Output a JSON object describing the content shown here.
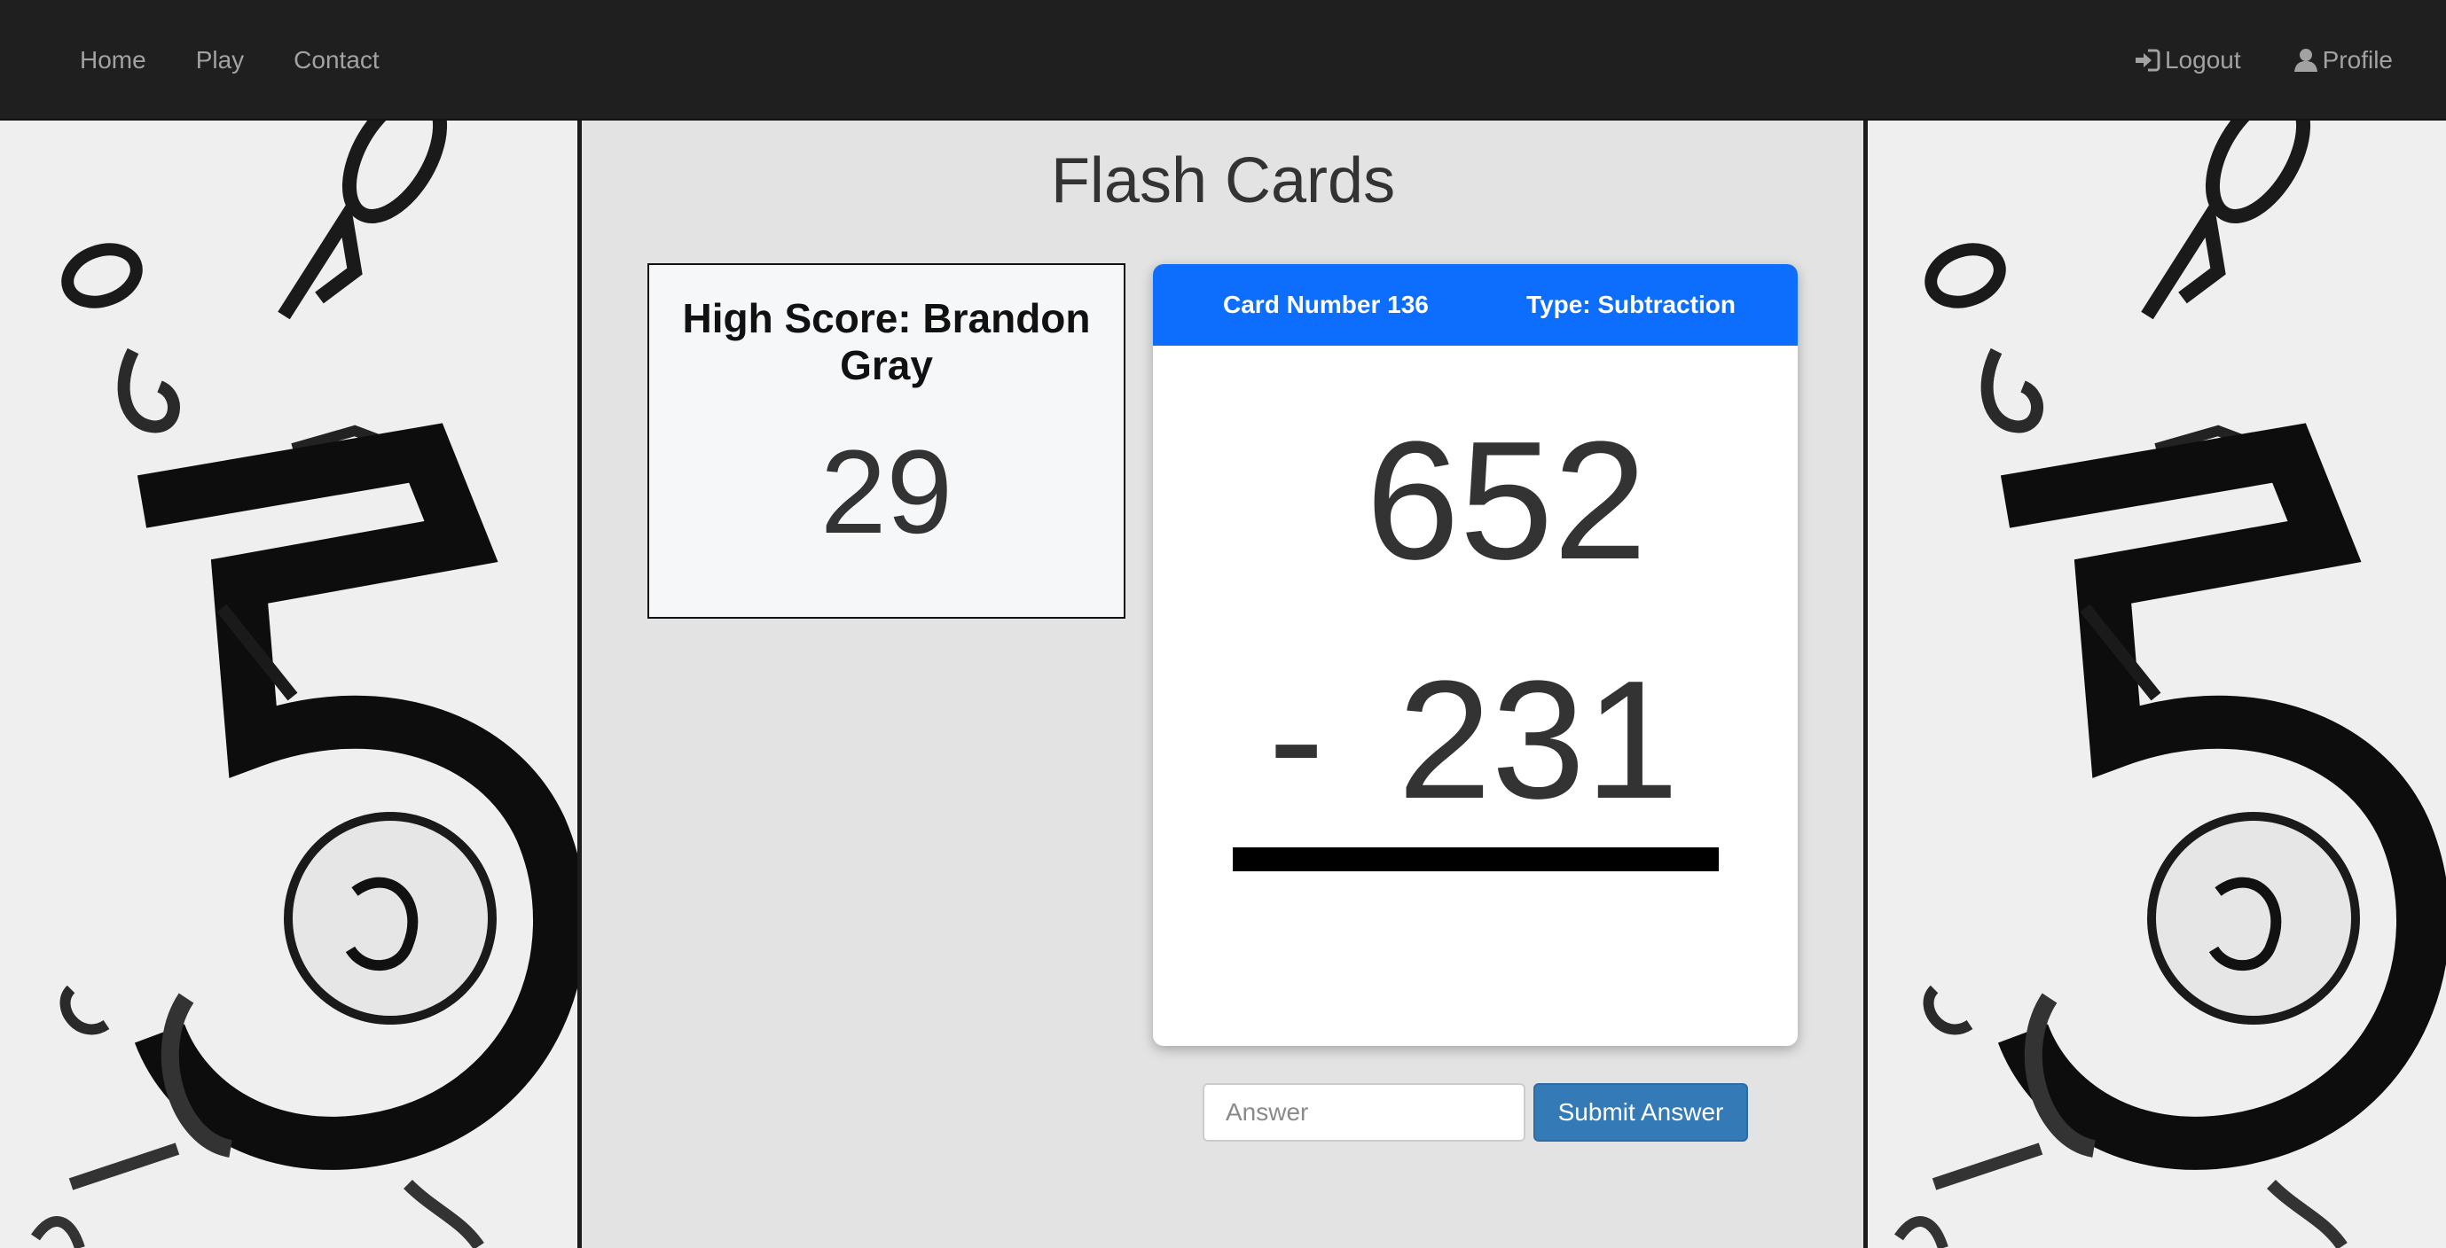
{
  "nav": {
    "left_links": [
      {
        "label": "Home"
      },
      {
        "label": "Play"
      },
      {
        "label": "Contact"
      }
    ],
    "logout_label": "Logout",
    "profile_label": "Profile"
  },
  "page": {
    "title": "Flash Cards"
  },
  "high_score": {
    "label": "High Score: Brandon Gray",
    "value": "29"
  },
  "card": {
    "number_label": "Card Number 136",
    "type_label": "Type: Subtraction",
    "top_operand": "652",
    "operator": "-",
    "bottom_operand": "231"
  },
  "answer_form": {
    "placeholder": "Answer",
    "submit_label": "Submit Answer"
  },
  "colors": {
    "navbar": "#1f1f1f",
    "card_header": "#0d6efd",
    "submit_button": "#337ab7",
    "page_background": "#e3e3e3"
  },
  "icons": {
    "logout": "sign-in-icon",
    "profile": "user-icon"
  }
}
